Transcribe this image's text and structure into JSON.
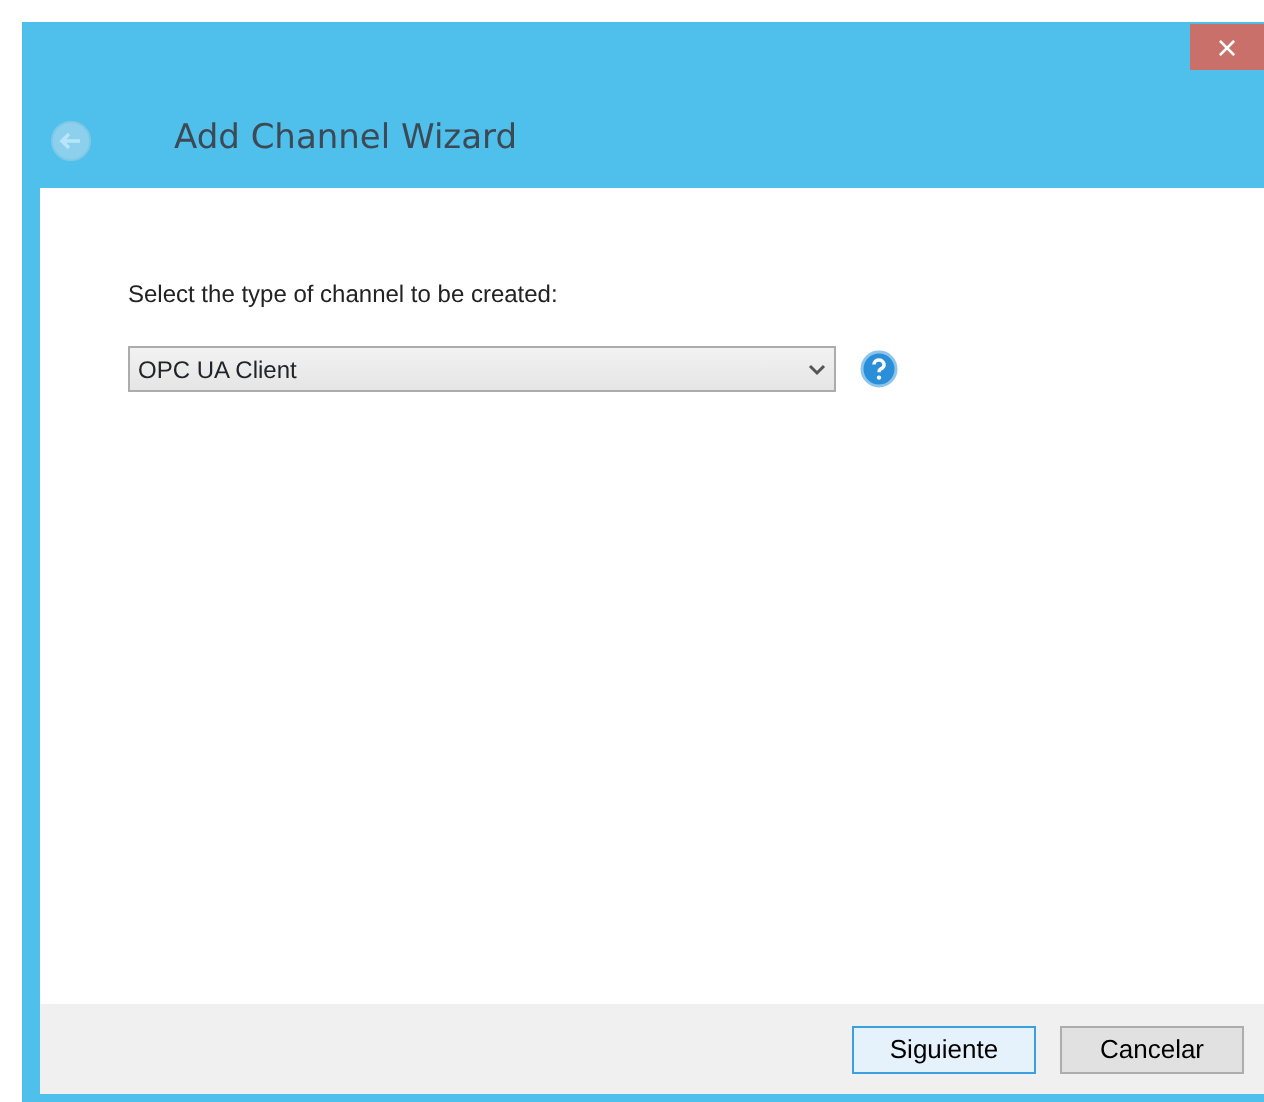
{
  "window": {
    "title": "Add Channel Wizard",
    "close": "×",
    "back_disabled": true
  },
  "prompt": "Select the type of channel to be created:",
  "channel_type": {
    "value": "OPC UA Client"
  },
  "buttons": [
    {
      "label": "Siguiente",
      "focused": true
    },
    {
      "label": "Cancelar",
      "focused": false
    }
  ]
}
